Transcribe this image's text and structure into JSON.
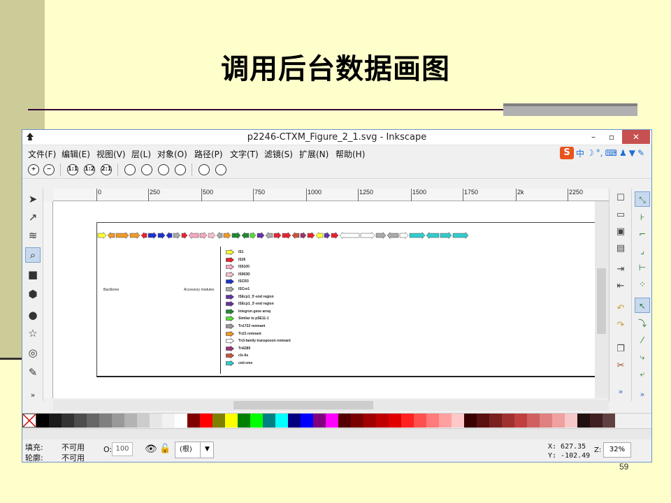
{
  "slide": {
    "title": "调用后台数据画图",
    "page_number": "59"
  },
  "window": {
    "title": "p2246-CTXM_Figure_2_1.svg - Inkscape",
    "minimize": "–",
    "maximize": "▫",
    "close": "✕"
  },
  "menubar": {
    "items": [
      "文件(F)",
      "编辑(E)",
      "视图(V)",
      "层(L)",
      "对象(O)",
      "路径(P)",
      "文字(T)",
      "滤镜(S)",
      "扩展(N)",
      "帮助(H)"
    ],
    "ime": {
      "logo": "S",
      "mode": "中"
    }
  },
  "zoombar": {
    "buttons": [
      "+",
      "−",
      "1:1",
      "1:2",
      "2:1"
    ]
  },
  "ruler": {
    "labels": [
      "0",
      "250",
      "500",
      "750",
      "1000",
      "1250",
      "1500",
      "1750",
      "2k",
      "2250"
    ]
  },
  "canvas": {
    "backbone_label": "Backbone",
    "accessory_label": "Accessory modules",
    "legend": [
      {
        "label": "IS1",
        "color": "#ffff33"
      },
      {
        "label": "IS26",
        "color": "#e8232f"
      },
      {
        "label": "IS5100",
        "color": "#f7a9c0"
      },
      {
        "label": "IS903D",
        "color": "#f7c1cf"
      },
      {
        "label": "ISCR3",
        "color": "#2233cc"
      },
      {
        "label": "ISCro1",
        "color": "#aaaaaa"
      },
      {
        "label": "ISEcp1_5'-end region",
        "color": "#6633aa"
      },
      {
        "label": "ISEcp1_3'-end region",
        "color": "#663399"
      },
      {
        "label": "Integron gene array",
        "color": "#228833"
      },
      {
        "label": "Similar to pSE11-1",
        "color": "#55dd33"
      },
      {
        "label": "Tn1722 remnant",
        "color": "#999999"
      },
      {
        "label": "Tn21 remnant",
        "color": "#f09a2a"
      },
      {
        "label": "Tn3-family transposon remnant",
        "color": "#ffffff"
      },
      {
        "label": "Tn6285",
        "color": "#993377"
      },
      {
        "label": "cls-lis",
        "color": "#c8553d"
      },
      {
        "label": "cml-cmx",
        "color": "#33cccc"
      }
    ]
  },
  "palette": {
    "colors": [
      "#000000",
      "#1a1a1a",
      "#333333",
      "#4d4d4d",
      "#666666",
      "#808080",
      "#999999",
      "#b3b3b3",
      "#cccccc",
      "#e6e6e6",
      "#f2f2f2",
      "#ffffff",
      "#800000",
      "#ff0000",
      "#808000",
      "#ffff00",
      "#008000",
      "#00ff00",
      "#008080",
      "#00ffff",
      "#000080",
      "#0000ff",
      "#800080",
      "#ff00ff",
      "#550000",
      "#7a0000",
      "#a00000",
      "#c00000",
      "#e00000",
      "#ff2020",
      "#ff5050",
      "#ff7a7a",
      "#ffa0a0",
      "#ffc8c8",
      "#3a0000",
      "#5a1010",
      "#7a2020",
      "#a03030",
      "#c04040",
      "#d06060",
      "#e08080",
      "#f0a0a0",
      "#f8c8c8",
      "#201010",
      "#402020",
      "#604040"
    ]
  },
  "statusbar": {
    "fill_label": "填充:",
    "fill_value": "不可用",
    "stroke_label": "轮廓:",
    "stroke_value": "不可用",
    "opacity_label": "O:",
    "opacity_value": "100",
    "layer": "(根)",
    "x_coord": "X:  627.35",
    "y_coord": "Y: -102.49",
    "zoom_label": "Z:",
    "zoom_value": "32%"
  }
}
